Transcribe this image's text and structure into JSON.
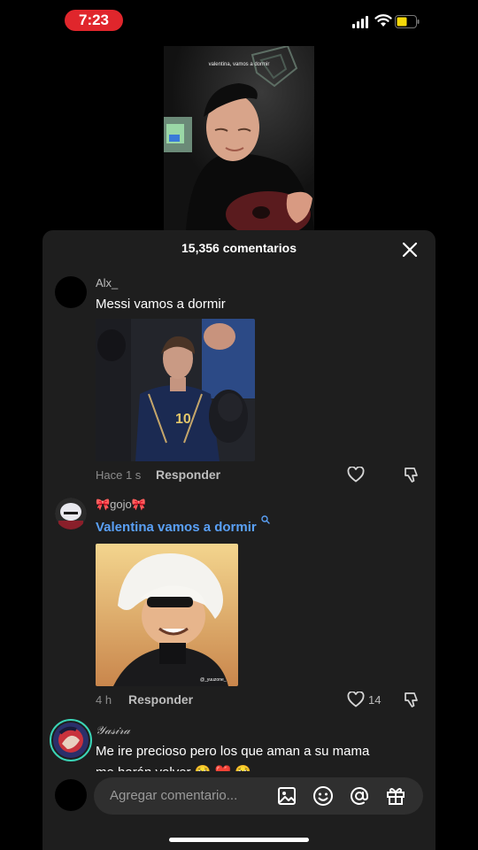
{
  "status_bar": {
    "time": "7:23"
  },
  "video": {
    "caption": "valentina, vamos a dormir"
  },
  "comments_sheet": {
    "title": "15,356 comentarios",
    "comments": [
      {
        "username": "Alx_",
        "text": "Messi vamos a dormir",
        "image_jersey_number": "10",
        "time": "Hace 1 s",
        "reply_label": "Responder",
        "likes": ""
      },
      {
        "username": "🎀gojo🎀",
        "text": "Valentina vamos a dormir",
        "image_watermark": "@_yuuzone_",
        "time": "4 h",
        "reply_label": "Responder",
        "likes": "14"
      },
      {
        "username": "𝒴𝒶𝓈𝒾𝓇𝒶",
        "text": "Me ire precioso pero los que aman a su mama",
        "text_line2": "me harán volver 🥹 ❤️ 🥹"
      }
    ],
    "input": {
      "placeholder": "Agregar comentario..."
    }
  },
  "colors": {
    "accent_link": "#5aa0f5",
    "time_pill": "#e0262c",
    "sheet_bg": "#1e1e1e"
  },
  "icons": [
    "signal-icon",
    "wifi-icon",
    "battery-icon",
    "close-icon",
    "heart-icon",
    "dislike-icon",
    "image-icon",
    "emoji-icon",
    "mention-icon",
    "gift-icon"
  ]
}
